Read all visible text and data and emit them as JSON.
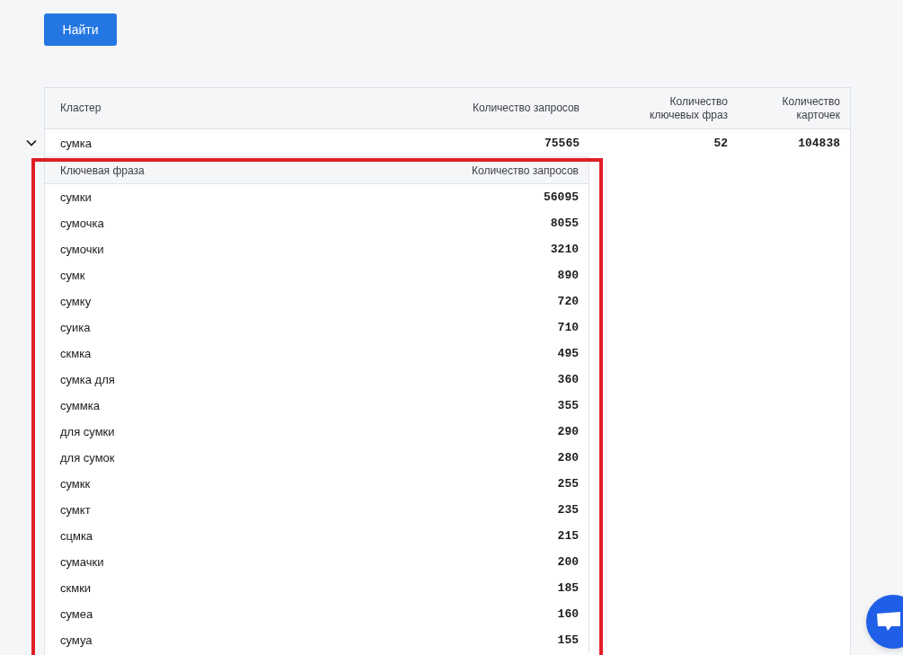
{
  "search_button": "Найти",
  "table": {
    "columns": [
      "Кластер",
      "Количество запросов",
      "Количество ключевых фраз",
      "Количество карточек"
    ],
    "rows": [
      {
        "cluster": "сумка",
        "queries": "75565",
        "phrases": "52",
        "cards": "104838",
        "expanded": true,
        "keywords": {
          "columns": [
            "Ключевая фраза",
            "Количество запросов"
          ],
          "rows": [
            {
              "phrase": "сумки",
              "queries": "56095"
            },
            {
              "phrase": "сумочка",
              "queries": "8055"
            },
            {
              "phrase": "сумочки",
              "queries": "3210"
            },
            {
              "phrase": "сумк",
              "queries": "890"
            },
            {
              "phrase": "сумку",
              "queries": "720"
            },
            {
              "phrase": "суика",
              "queries": "710"
            },
            {
              "phrase": "скмка",
              "queries": "495"
            },
            {
              "phrase": "сумка для",
              "queries": "360"
            },
            {
              "phrase": "суммка",
              "queries": "355"
            },
            {
              "phrase": "для сумки",
              "queries": "290"
            },
            {
              "phrase": "для сумок",
              "queries": "280"
            },
            {
              "phrase": "сумкк",
              "queries": "255"
            },
            {
              "phrase": "сумкт",
              "queries": "235"
            },
            {
              "phrase": "сцмка",
              "queries": "215"
            },
            {
              "phrase": "сумачки",
              "queries": "200"
            },
            {
              "phrase": "скмки",
              "queries": "185"
            },
            {
              "phrase": "сумеа",
              "queries": "160"
            },
            {
              "phrase": "сумуа",
              "queries": "155"
            }
          ]
        }
      }
    ]
  }
}
